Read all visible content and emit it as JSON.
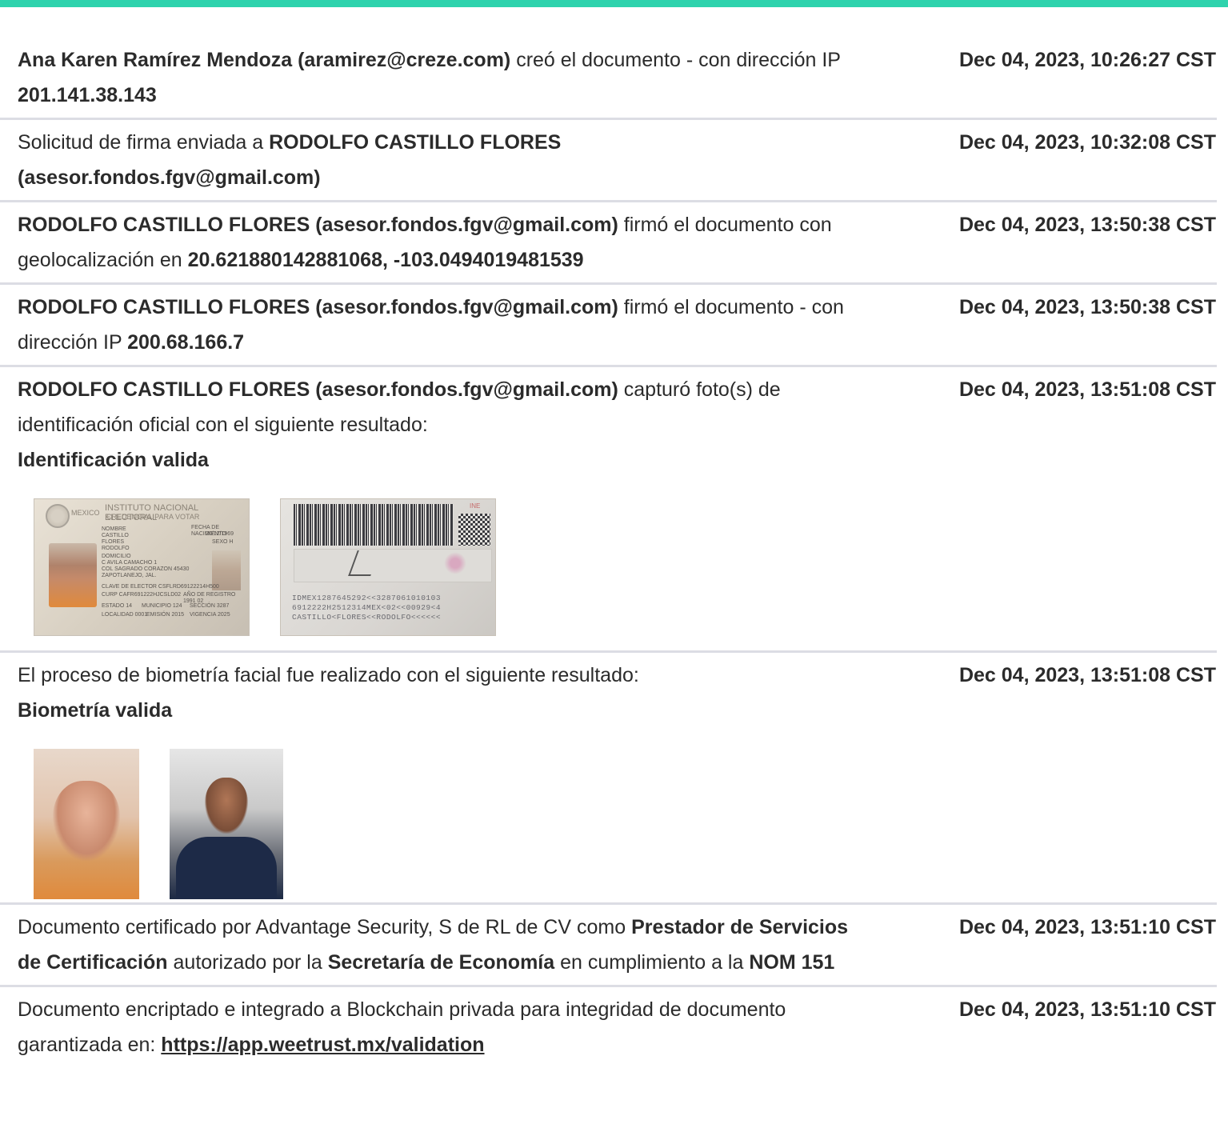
{
  "colors": {
    "accent": "#2ed3ad",
    "divider": "#dcdde4",
    "text": "#2b2b2b"
  },
  "rows": [
    {
      "segments": [
        {
          "t": "Ana Karen Ramírez Mendoza (aramirez@creze.com)",
          "b": true
        },
        {
          "t": " creó el documento - con dirección IP ",
          "b": false
        },
        {
          "t": "201.141.38.143",
          "b": true
        }
      ],
      "timestamp": "Dec 04, 2023, 10:26:27 CST"
    },
    {
      "segments": [
        {
          "t": "Solicitud de firma enviada a ",
          "b": false
        },
        {
          "t": "RODOLFO CASTILLO FLORES (asesor.fondos.fgv@gmail.com)",
          "b": true
        }
      ],
      "timestamp": "Dec 04, 2023, 10:32:08 CST"
    },
    {
      "segments": [
        {
          "t": "RODOLFO CASTILLO FLORES (asesor.fondos.fgv@gmail.com)",
          "b": true
        },
        {
          "t": " firmó el documento con geolocalización en ",
          "b": false
        },
        {
          "t": "20.621880142881068, -103.0494019481539",
          "b": true
        }
      ],
      "timestamp": "Dec 04, 2023, 13:50:38 CST"
    },
    {
      "segments": [
        {
          "t": "RODOLFO CASTILLO FLORES (asesor.fondos.fgv@gmail.com)",
          "b": true
        },
        {
          "t": " firmó el documento - con dirección IP ",
          "b": false
        },
        {
          "t": "200.68.166.7",
          "b": true
        }
      ],
      "timestamp": "Dec 04, 2023, 13:50:38 CST"
    },
    {
      "segments": [
        {
          "t": "RODOLFO CASTILLO FLORES (asesor.fondos.fgv@gmail.com)",
          "b": true
        },
        {
          "t": " capturó foto(s) de identificación oficial con el siguiente resultado:",
          "b": false
        },
        {
          "t": "Identificación valida",
          "b": true,
          "br": true
        }
      ],
      "timestamp": "Dec 04, 2023, 13:51:08 CST"
    },
    {
      "segments": [
        {
          "t": "El proceso de biometría facial fue realizado con el siguiente resultado:",
          "b": false
        },
        {
          "t": "Biometría valida",
          "b": true,
          "br": true
        }
      ],
      "timestamp": "Dec 04, 2023, 13:51:08 CST"
    },
    {
      "segments": [
        {
          "t": "Documento certificado por Advantage Security, S de RL de CV como ",
          "b": false
        },
        {
          "t": "Prestador de Servicios de Certificación",
          "b": true
        },
        {
          "t": " autorizado por la ",
          "b": false
        },
        {
          "t": "Secretaría de Economía",
          "b": true
        },
        {
          "t": " en cumplimiento a la ",
          "b": false
        },
        {
          "t": "NOM 151",
          "b": true
        }
      ],
      "timestamp": "Dec 04, 2023, 13:51:10 CST"
    },
    {
      "segments": [
        {
          "t": "Documento encriptado e integrado a Blockchain privada para integridad de documento garantizada en: ",
          "b": false
        },
        {
          "t": "https://app.weetrust.mx/validation",
          "b": true,
          "link": true
        }
      ],
      "timestamp": "Dec 04, 2023, 13:51:10 CST"
    }
  ],
  "id_front": {
    "country": "MEXICO",
    "institute": "INSTITUTO NACIONAL ELECTORAL",
    "card_type": "CREDENCIAL PARA VOTAR",
    "label_name": "NOMBRE",
    "name_lines": [
      "CASTILLO",
      "FLORES",
      "RODOLFO"
    ],
    "label_address": "DOMICILIO",
    "address_lines": [
      "C AVILA CAMACHO 1",
      "COL SAGRADO CORAZON 45430",
      "ZAPOTLANEJO, JAL."
    ],
    "label_birth": "FECHA DE NACIMIENTO",
    "birth_date": "20/12/1969",
    "sex": "SEXO H",
    "elector_key": "CLAVE DE ELECTOR CSFLRD69122214H500",
    "curp": "CURP CAFR691222HJCSLD02",
    "registration": "AÑO DE REGISTRO 1991 02",
    "estado": "ESTADO 14",
    "municipio": "MUNICIPIO 124",
    "seccion": "SECCIÓN 3287",
    "localidad": "LOCALIDAD 0001",
    "emision": "EMISIÓN 2015",
    "vigencia": "VIGENCIA 2025"
  },
  "id_back": {
    "brand": "INE",
    "mrz": [
      "IDMEX1287645292<<3287061010103",
      "6912222H2512314MEX<02<<00929<4",
      "CASTILLO<FLORES<<RODOLFO<<<<<<"
    ]
  }
}
